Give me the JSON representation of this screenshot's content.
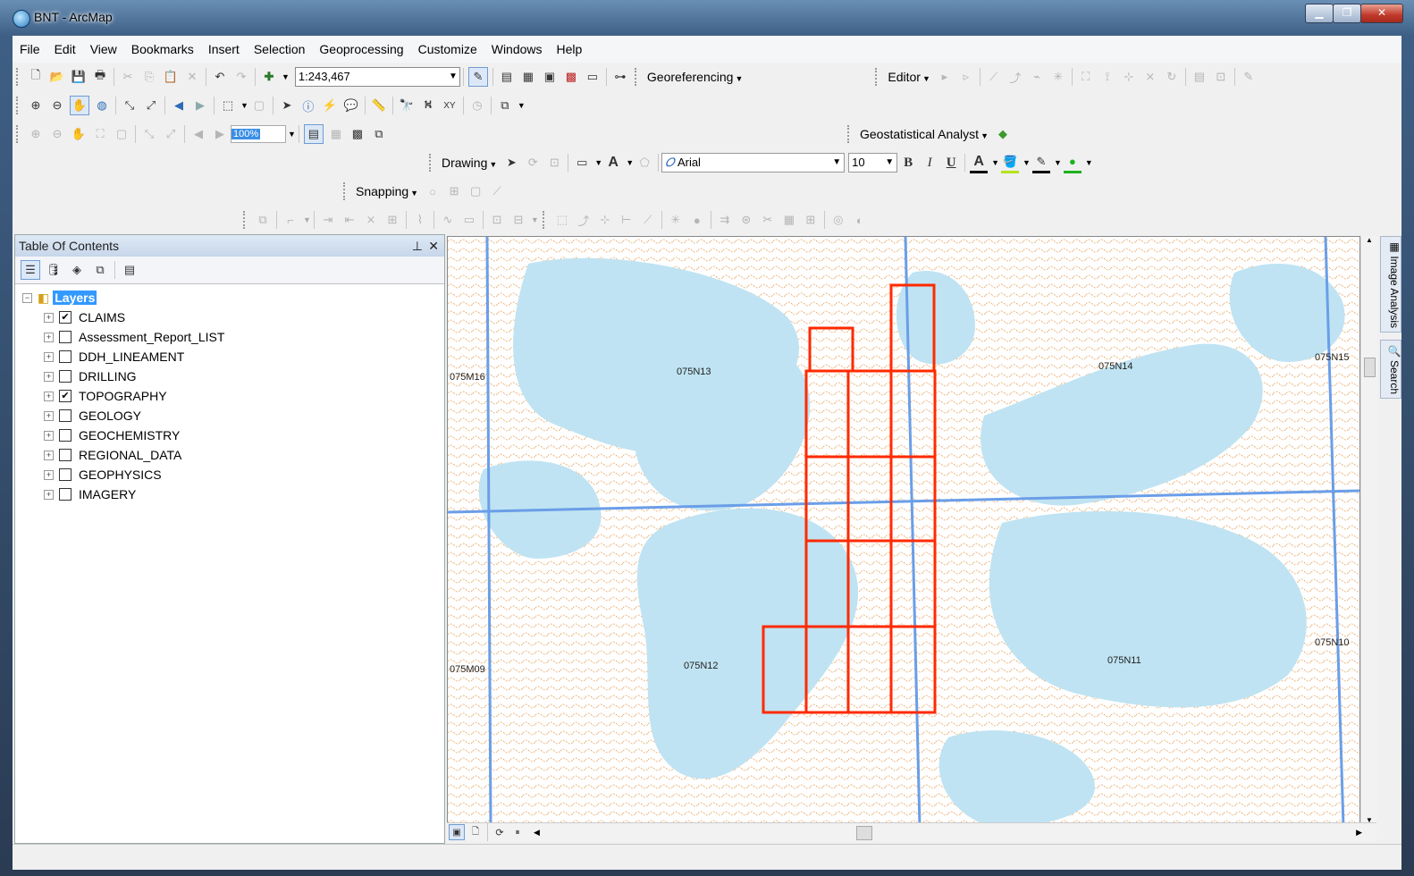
{
  "window": {
    "title": "BNT - ArcMap"
  },
  "menu": [
    "File",
    "Edit",
    "View",
    "Bookmarks",
    "Insert",
    "Selection",
    "Geoprocessing",
    "Customize",
    "Windows",
    "Help"
  ],
  "toolbar": {
    "scale": "1:243,467",
    "georeferencing": "Georeferencing",
    "editor": "Editor",
    "geostat": "Geostatistical Analyst",
    "drawing": "Drawing",
    "font": "Arial",
    "font_size": "10",
    "snapping": "Snapping",
    "zoom": "100%",
    "bold": "B",
    "italic": "I",
    "underline": "U",
    "text_color": "A"
  },
  "toc": {
    "title": "Table Of Contents",
    "root": "Layers",
    "layers": [
      {
        "name": "CLAIMS",
        "checked": "✔"
      },
      {
        "name": "Assessment_Report_LIST",
        "checked": ""
      },
      {
        "name": "DDH_LINEAMENT",
        "checked": ""
      },
      {
        "name": "DRILLING",
        "checked": ""
      },
      {
        "name": "TOPOGRAPHY",
        "checked": "✔"
      },
      {
        "name": "GEOLOGY",
        "checked": ""
      },
      {
        "name": "GEOCHEMISTRY",
        "checked": ""
      },
      {
        "name": "REGIONAL_DATA",
        "checked": ""
      },
      {
        "name": "GEOPHYSICS",
        "checked": ""
      },
      {
        "name": "IMAGERY",
        "checked": ""
      }
    ]
  },
  "map": {
    "labels": [
      "075M16",
      "075N13",
      "075N14",
      "075N15",
      "075M09",
      "075N12",
      "075N11",
      "075N10"
    ],
    "colors": {
      "water": "#bfe3f2",
      "grid": "#6a9ee8",
      "claims": "#ff2a00",
      "contour": "#e8a15a"
    }
  },
  "side_tabs": [
    "Image Analysis",
    "Search"
  ]
}
